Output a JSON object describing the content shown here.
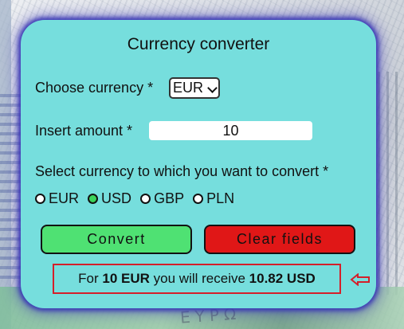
{
  "card": {
    "title": "Currency converter",
    "choose_label": "Choose currency *",
    "selected_currency": "EUR",
    "amount_label": "Insert amount *",
    "amount_value": "10",
    "target_label": "Select currency to which you want to convert *",
    "target_options": [
      {
        "label": "EUR",
        "checked": false
      },
      {
        "label": "USD",
        "checked": true
      },
      {
        "label": "GBP",
        "checked": false
      },
      {
        "label": "PLN",
        "checked": false
      }
    ],
    "convert_label": "Convert",
    "clear_label": "Clear fields",
    "result": {
      "prefix": "For",
      "from_amount": "10 EUR",
      "middle": "you will receive",
      "to_amount": "10.82 USD"
    }
  },
  "colors": {
    "card_bg": "#76dedd",
    "glow": "#3a37b5",
    "convert_bg": "#4fe173",
    "clear_bg": "#e01717",
    "highlight_border": "#d41f2a",
    "radio_selected": "#3bd35a"
  },
  "icons": {
    "annotation_arrow": "left-arrow-outline-icon",
    "select_chevron": "chevron-down-icon"
  }
}
